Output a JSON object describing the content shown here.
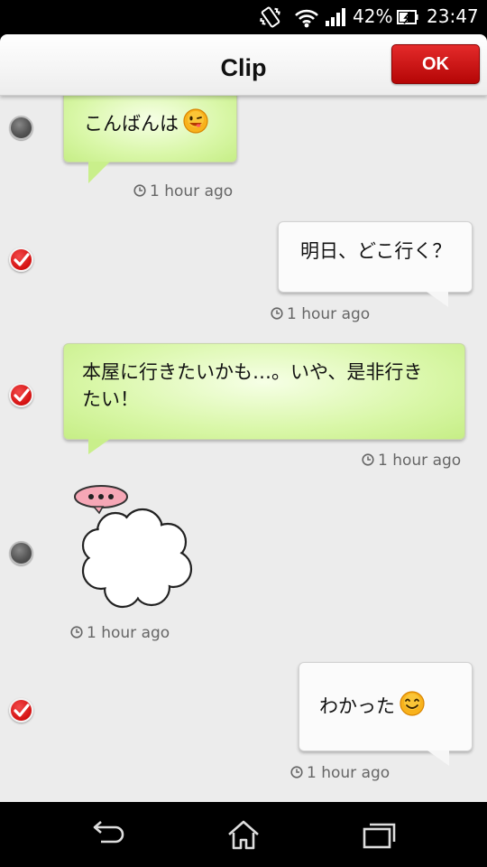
{
  "status_bar": {
    "battery_percent": "42%",
    "time": "23:47",
    "icons": [
      "vibrate-icon",
      "wifi-icon",
      "signal-icon",
      "battery-icon"
    ]
  },
  "header": {
    "title": "Clip",
    "ok_label": "OK"
  },
  "messages": [
    {
      "text": "こんばんは",
      "emoji": "smiley-wink-icon",
      "side": "left",
      "selected": false,
      "timestamp": "1 hour ago"
    },
    {
      "text": "明日、どこ行く？",
      "side": "right",
      "selected": true,
      "timestamp": "1 hour ago"
    },
    {
      "text_line1": "本屋に行きたいかも…。いや、是非行き",
      "text_line2": "たい！",
      "side": "left",
      "selected": true,
      "timestamp": "1 hour ago"
    },
    {
      "sticker": "thinking-cloud-sticker",
      "sticker_text": "•••",
      "side": "left",
      "selected": false,
      "timestamp": "1 hour ago"
    },
    {
      "text": "わかった",
      "emoji": "smiley-icon",
      "side": "right",
      "selected": true,
      "timestamp": "1 hour ago"
    }
  ],
  "colors": {
    "ok_button": "#c40c0c",
    "green_bubble": "#d9f7a8",
    "selected_radio": "#d41010",
    "unselected_radio": "#555555"
  },
  "nav": {
    "icons": [
      "back-icon",
      "home-icon",
      "recent-apps-icon"
    ]
  }
}
